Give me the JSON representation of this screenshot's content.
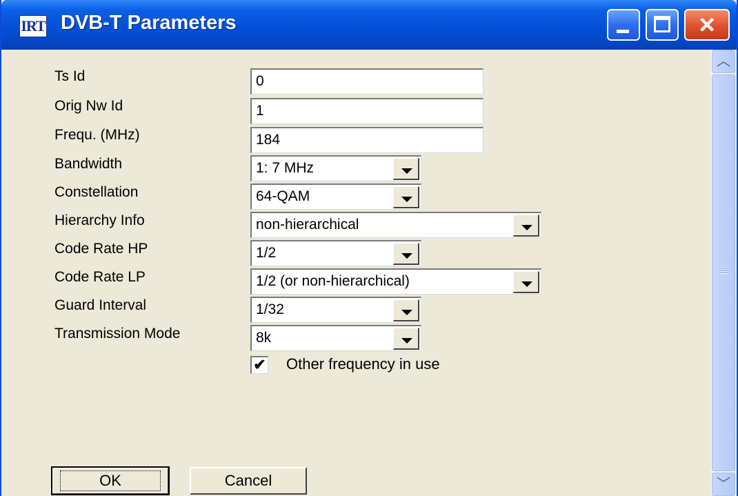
{
  "window": {
    "icon_text": "IRT",
    "title": "DVB-T Parameters",
    "controls": {
      "minimize": "minimize",
      "maximize": "maximize",
      "close": "×"
    }
  },
  "fields": {
    "ts_id": {
      "label": "Ts Id",
      "value": "0"
    },
    "orig_nw_id": {
      "label": "Orig Nw Id",
      "value": "1"
    },
    "frequency": {
      "label": "Frequ. (MHz)",
      "value": "184"
    },
    "bandwidth": {
      "label": "Bandwidth",
      "value": "1: 7 MHz"
    },
    "constellation": {
      "label": "Constellation",
      "value": "64-QAM"
    },
    "hierarchy_info": {
      "label": "Hierarchy Info",
      "value": "non-hierarchical"
    },
    "code_rate_hp": {
      "label": "Code Rate HP",
      "value": "1/2"
    },
    "code_rate_lp": {
      "label": "Code Rate LP",
      "value": "1/2 (or non-hierarchical)"
    },
    "guard_interval": {
      "label": "Guard Interval",
      "value": "1/32"
    },
    "transmission_mode": {
      "label": "Transmission Mode",
      "value": "8k"
    }
  },
  "other_frequency": {
    "label": "Other frequency in use",
    "checked": true,
    "mark": "✔"
  },
  "buttons": {
    "ok": "OK",
    "cancel": "Cancel"
  },
  "scrollbar": {
    "up": "︿",
    "down": "﹀"
  }
}
